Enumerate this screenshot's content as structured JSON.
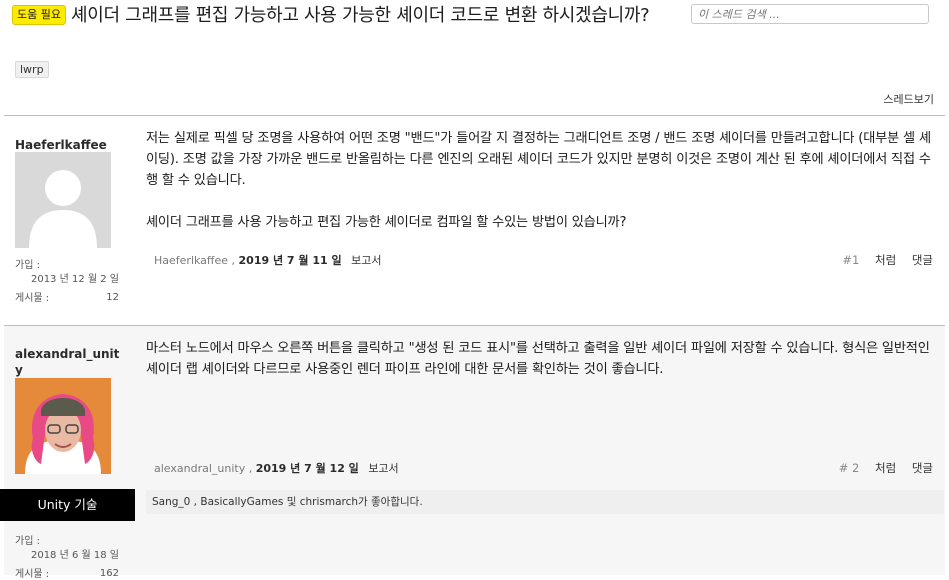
{
  "thread": {
    "badge": "도움 필요",
    "title": "셰이더 그래프를 편집 가능하고 사용 가능한 셰이더 코드로 변환 하시겠습니까?",
    "search_placeholder": "이 스레드 검색 ...",
    "tag": "lwrp",
    "tools_label": "스레드보기"
  },
  "posts": [
    {
      "username": "Haeferlkaffee",
      "joined_label": "가입 :",
      "joined_value": "2013 년 12 월 2 일",
      "posts_label": "게시물 :",
      "posts_value": "12",
      "body_p1": "저는 실제로 픽셀 당 조명을 사용하여 어떤 조명 \"밴드\"가 들어갈 지 결정하는 그래디언트 조명 / 밴드 조명 셰이더를 만들려고합니다 (대부분 셀 셰이딩). 조명 값을 가장 가까운 밴드로 반올림하는 다른 엔진의 오래된 셰이더 코드가 있지만 분명히 이것은 조명이 계산 된 후에 셰이더에서 직접 수행 할 수 있습니다.",
      "body_p2": "셰이더 그래프를 사용 가능하고 편집 가능한 셰이더로 컴파일 할 수있는 방법이 있습니까?",
      "footer_user": "Haeferlkaffee ,",
      "footer_date": "2019 년 7 월 11 일",
      "report": "보고서",
      "number": "#1",
      "quote": "처럼",
      "reply": "댓글"
    },
    {
      "username": "alexandral_unity",
      "role": "Unity 기술",
      "joined_label": "가입 :",
      "joined_value": "2018 년 6 월 18 일",
      "posts_label": "게시물 :",
      "posts_value": "162",
      "body_p1": "마스터 노드에서 마우스 오른쪽 버튼을 클릭하고 \"생성 된 코드 표시\"를 선택하고 출력을 일반 셰이더 파일에 저장할 수 있습니다. 형식은 일반적인 셰이더 랩 셰이더와 다르므로 사용중인 렌더 파이프 라인에 대한 문서를 확인하는 것이 좋습니다.",
      "footer_user": "alexandral_unity ,",
      "footer_date": "2019 년 7 월 12 일",
      "report": "보고서",
      "number": "# 2",
      "quote": "처럼",
      "reply": "댓글",
      "likes": "Sang_0 , BasicallyGames 및 chrismarch가 좋아합니다."
    }
  ]
}
